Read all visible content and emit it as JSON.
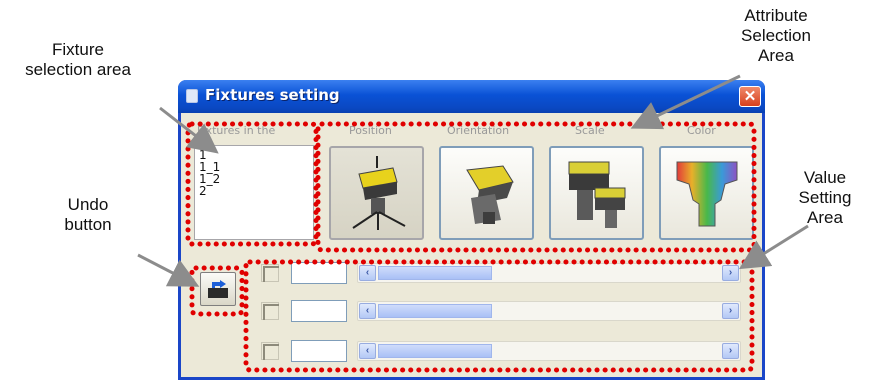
{
  "callouts": {
    "fixture_selection": [
      "Fixture",
      "selection area"
    ],
    "attribute_selection": [
      "Attribute",
      "Selection",
      "Area"
    ],
    "undo": [
      "Undo",
      "button"
    ],
    "value_setting": [
      "Value",
      "Setting",
      "Area"
    ]
  },
  "window": {
    "title": "Fixtures setting",
    "close_glyph": "✕"
  },
  "fixtures": {
    "label": "Fixtures in the",
    "items": [
      "1",
      "1_1",
      "1_2",
      "2"
    ]
  },
  "attributes": [
    {
      "label": "Position",
      "icon": "position-fixture-icon",
      "pressed": true
    },
    {
      "label": "Orientation",
      "icon": "orientation-fixture-icon",
      "pressed": false
    },
    {
      "label": "Scale",
      "icon": "scale-fixture-icon",
      "pressed": false
    },
    {
      "label": "Color",
      "icon": "color-fixture-icon",
      "pressed": false
    }
  ],
  "undo": {
    "icon": "undo-icon"
  },
  "value_rows": [
    {
      "value": "",
      "slider_fraction": 0.33
    },
    {
      "value": "",
      "slider_fraction": 0.33
    },
    {
      "value": "",
      "slider_fraction": 0.33
    }
  ],
  "colors": {
    "titlebar": "#0a52d6",
    "highlight_dots": "#e00000",
    "window_bg": "#ece9d8"
  }
}
